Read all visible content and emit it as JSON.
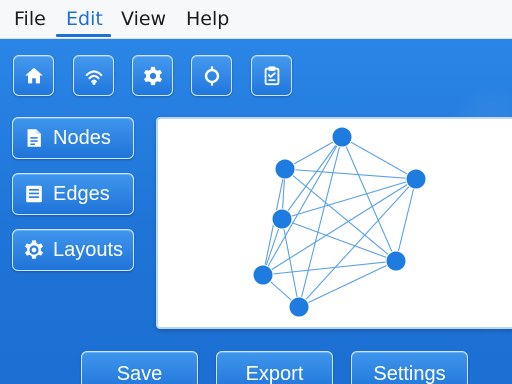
{
  "menu": {
    "items": [
      {
        "label": "File"
      },
      {
        "label": "Edit"
      },
      {
        "label": "View"
      },
      {
        "label": "Help"
      }
    ],
    "active": "Edit"
  },
  "toolbar": {
    "buttons": [
      {
        "icon": "home-icon"
      },
      {
        "icon": "wifi-icon"
      },
      {
        "icon": "gear-icon"
      },
      {
        "icon": "sun-icon"
      },
      {
        "icon": "clipboard-icon"
      }
    ]
  },
  "sidebar": {
    "items": [
      {
        "label": "Nodes",
        "icon": "document-icon"
      },
      {
        "label": "Edges",
        "icon": "list-icon"
      },
      {
        "label": "Layouts",
        "icon": "gear-icon"
      }
    ]
  },
  "graph": {
    "node_count": 7,
    "node_color": "#1e7be0",
    "edge_color": "#5aa1e8"
  },
  "actions": {
    "save_label": "Save",
    "export_label": "Export",
    "settings_label": "Settings"
  },
  "colors": {
    "accent": "#1e6fd9",
    "workspace": "#2179dc"
  }
}
